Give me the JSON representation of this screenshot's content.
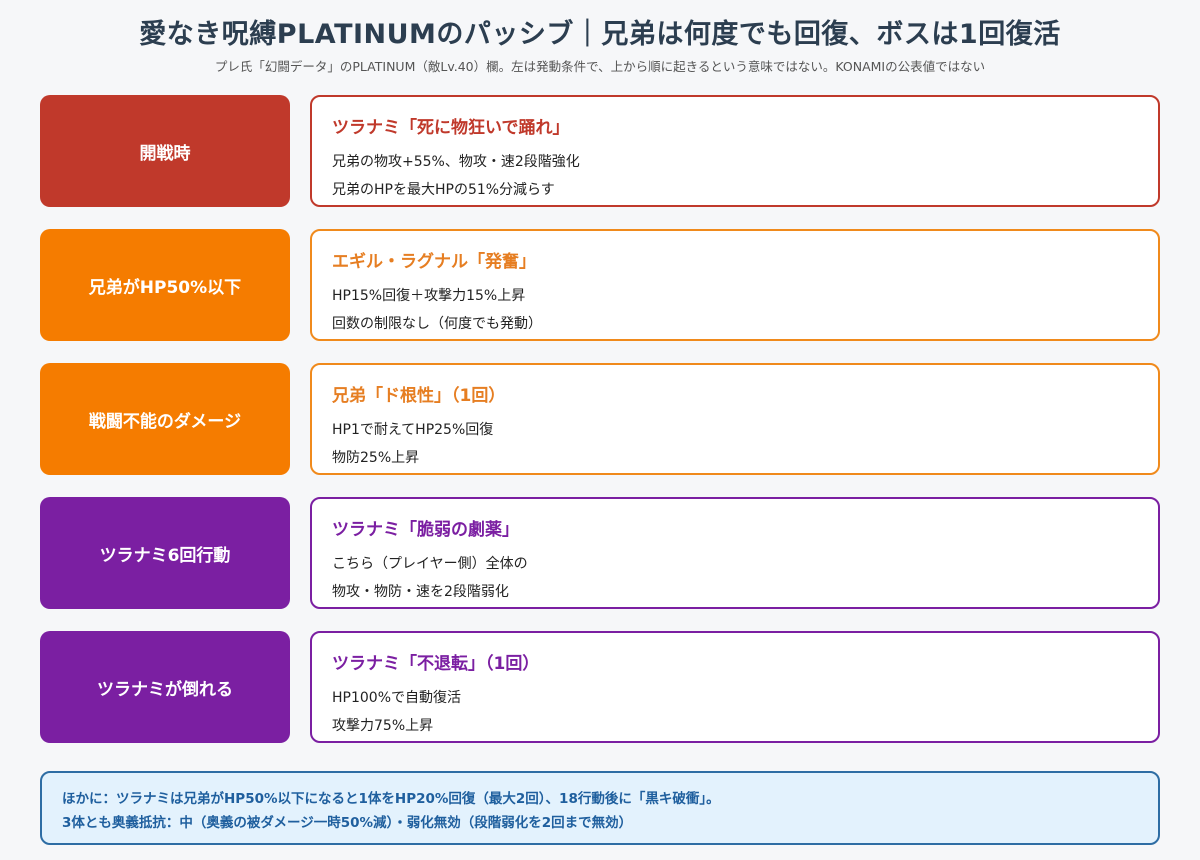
{
  "header": {
    "title": "愛なき呪縛PLATINUMのパッシブ｜兄弟は何度でも回復、ボスは1回復活",
    "subtitle": "プレ氏「幻闘データ」のPLATINUM（敵Lv.40）欄。左は発動条件で、上から順に起きるという意味ではない。KONAMIの公表値ではない"
  },
  "colors": {
    "red": "#c0392b",
    "orange": "#f57c00",
    "purple": "#7b1fa2",
    "note_border": "#2e6da4",
    "note_bg": "#e3f2fd"
  },
  "rows": [
    {
      "condition": "開戦時",
      "title": "ツラナミ「死に物狂いで踊れ」",
      "line1": "兄弟の物攻+55%、物攻・速2段階強化",
      "line2": "兄弟のHPを最大HPの51%分減らす"
    },
    {
      "condition": "兄弟がHP50%以下",
      "title": "エギル・ラグナル「発奮」",
      "line1": "HP15%回復＋攻撃力15%上昇",
      "line2": "回数の制限なし（何度でも発動）"
    },
    {
      "condition": "戦闘不能のダメージ",
      "title": "兄弟「ド根性」（1回）",
      "line1": "HP1で耐えてHP25%回復",
      "line2": "物防25%上昇"
    },
    {
      "condition": "ツラナミ6回行動",
      "title": "ツラナミ「脆弱の劇薬」",
      "line1": "こちら（プレイヤー側）全体の",
      "line2": "物攻・物防・速を2段階弱化"
    },
    {
      "condition": "ツラナミが倒れる",
      "title": "ツラナミ「不退転」（1回）",
      "line1": "HP100%で自動復活",
      "line2": "攻撃力75%上昇"
    }
  ],
  "note": {
    "line1": "ほかに：ツラナミは兄弟がHP50%以下になると1体をHP20%回復（最大2回）、18行動後に「黒キ破衝」。",
    "line2": "3体とも奥義抵抗：中（奥義の被ダメージ一時50%減）・弱化無効（段階弱化を2回まで無効）"
  }
}
